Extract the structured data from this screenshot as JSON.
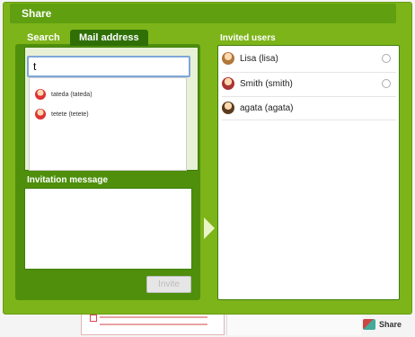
{
  "dialog": {
    "title": "Share"
  },
  "tabs": {
    "search": "Search",
    "mail": "Mail address"
  },
  "search_input": {
    "value": "t"
  },
  "suggestions": [
    "tateda (tateda)",
    "tetete (tetete)"
  ],
  "invitation": {
    "label": "Invitation message",
    "invite_button": "Invite"
  },
  "invited": {
    "label": "Invited users",
    "users": [
      "Lisa  (lisa)",
      "Smith  (smith)",
      "agata  (agata)"
    ]
  },
  "footer": {
    "share_label": "Share"
  },
  "colors": {
    "dialog_green": "#7db41a",
    "dark_green": "#4f8f0c",
    "title_green": "#5f9f10"
  }
}
